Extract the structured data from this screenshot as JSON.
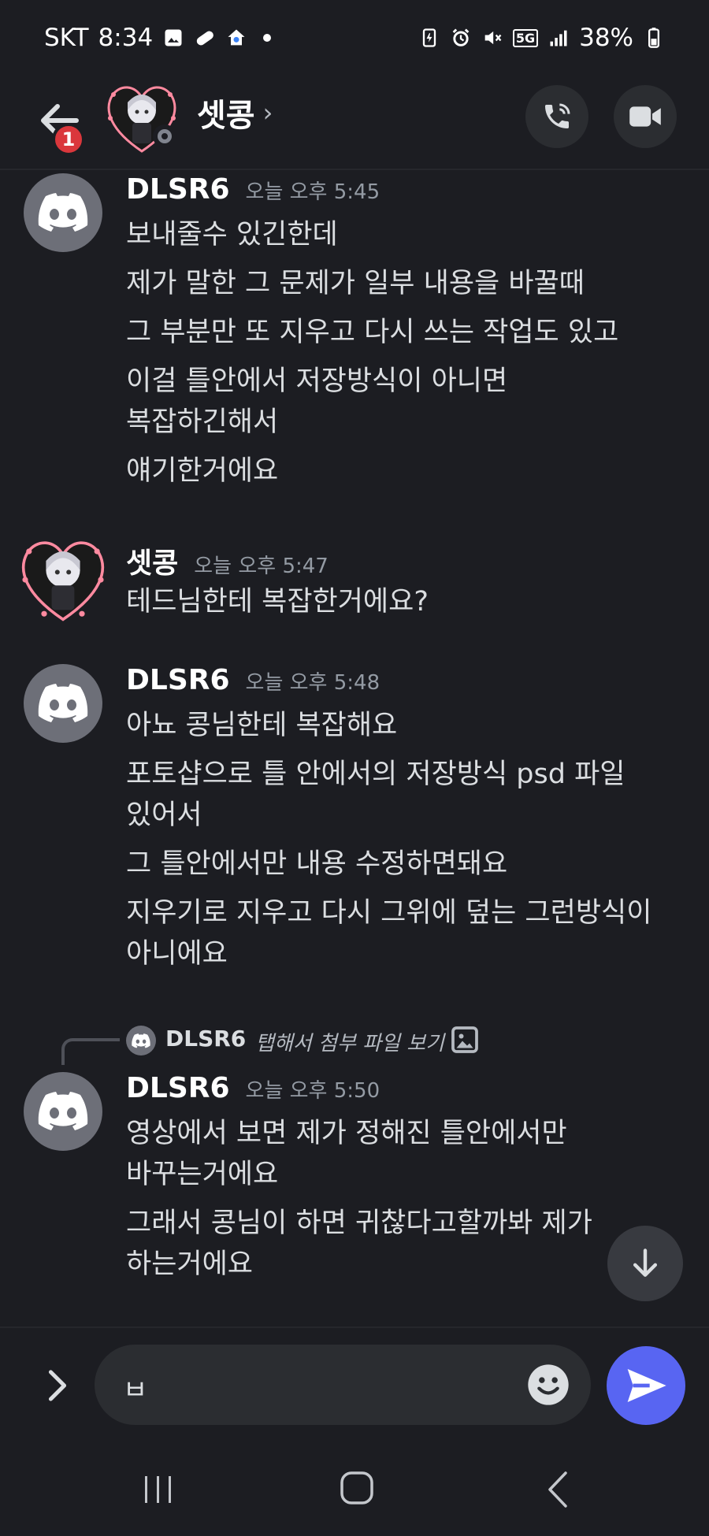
{
  "status_bar": {
    "carrier": "SKT",
    "time": "8:34",
    "network": "5G",
    "battery": "38%"
  },
  "header": {
    "notification_count": "1",
    "title": "셋콩",
    "chevron": "›"
  },
  "messages": [
    {
      "author": "DLSR6",
      "time": "오늘 오후 5:45",
      "lines": [
        "보내줄수 있긴한데",
        "제가 말한 그 문제가 일부 내용을 바꿀때",
        "그 부분만 또 지우고 다시 쓰는 작업도 있고",
        "이걸 틀안에서 저장방식이 아니면",
        "복잡하긴해서",
        "얘기한거에요"
      ]
    },
    {
      "author": "셋콩",
      "time": "오늘 오후 5:47",
      "lines": [
        "테드님한테 복잡한거에요?"
      ]
    },
    {
      "author": "DLSR6",
      "time": "오늘 오후 5:48",
      "lines": [
        "아뇨 콩님한테 복잡해요",
        "포토샵으로 틀 안에서의 저장방식 psd 파일",
        "있어서",
        "그 틀안에서만 내용 수정하면돼요",
        "지우기로 지우고 다시 그위에 덮는 그런방식이",
        "아니에요"
      ]
    },
    {
      "author": "DLSR6",
      "time": "오늘 오후 5:50",
      "reply": {
        "author": "DLSR6",
        "text": "탭해서 첨부 파일 보기"
      },
      "lines": [
        "영상에서 보면 제가 정해진 틀안에서만",
        "바꾸는거에요",
        "그래서 콩님이 하면 귀찮다고할까봐 제가",
        "하는거에요"
      ]
    }
  ],
  "composer": {
    "input_value": "ㅂ"
  },
  "colors": {
    "background": "#1c1d22",
    "accent": "#5865f2",
    "badge": "#da373c"
  },
  "icons": [
    "back-arrow-icon",
    "phone-call-icon",
    "video-camera-icon",
    "discord-logo-icon",
    "image-icon",
    "arrow-down-icon",
    "chevron-right-icon",
    "emoji-icon",
    "send-icon"
  ]
}
